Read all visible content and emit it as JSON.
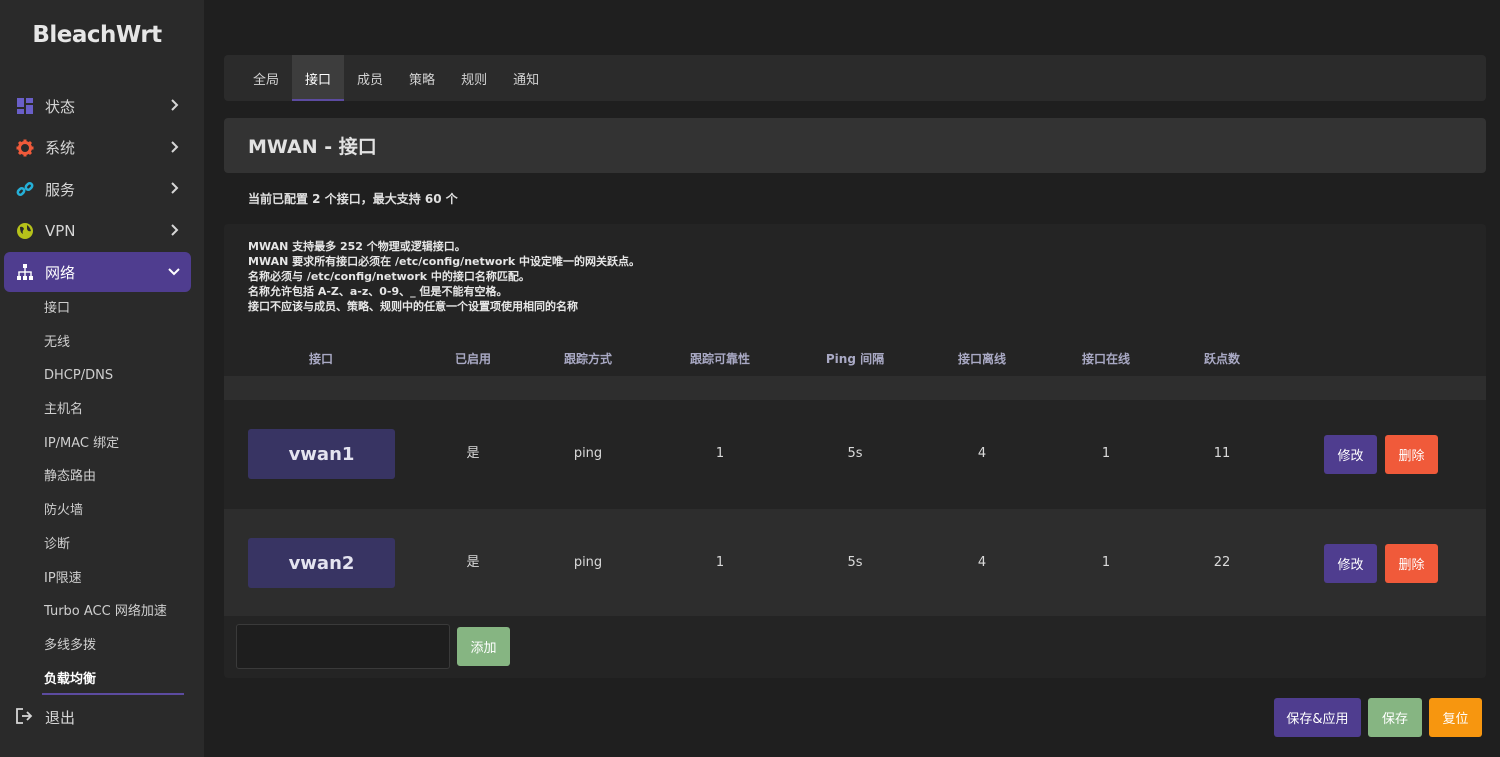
{
  "brand": "BleachWrt",
  "sidebar": {
    "items": [
      {
        "label": "状态",
        "icon": "dashboard-icon",
        "color": "#6a5fc8"
      },
      {
        "label": "系统",
        "icon": "gear-icon",
        "color": "#f05a3a"
      },
      {
        "label": "服务",
        "icon": "link-icon",
        "color": "#25b0d8"
      },
      {
        "label": "VPN",
        "icon": "globe-icon",
        "color": "#b6c21a"
      },
      {
        "label": "网络",
        "icon": "network-icon",
        "color": "#ffffff"
      }
    ],
    "network_sub": [
      "接口",
      "无线",
      "DHCP/DNS",
      "主机名",
      "IP/MAC 绑定",
      "静态路由",
      "防火墙",
      "诊断",
      "IP限速",
      "Turbo ACC 网络加速",
      "多线多拨",
      "负载均衡"
    ],
    "logout": "退出"
  },
  "tabs": [
    "全局",
    "接口",
    "成员",
    "策略",
    "规则",
    "通知"
  ],
  "active_tab": "接口",
  "page_title": "MWAN - 接口",
  "summary": "当前已配置 2 个接口，最大支持 60 个",
  "notes": [
    "MWAN 支持最多 252 个物理或逻辑接口。",
    "MWAN 要求所有接口必须在 /etc/config/network 中设定唯一的网关跃点。",
    "名称必须与 /etc/config/network 中的接口名称匹配。",
    "名称允许包括 A-Z、a-z、0-9、_ 但是不能有空格。",
    "接口不应该与成员、策略、规则中的任意一个设置项使用相同的名称"
  ],
  "table": {
    "headers": [
      "接口",
      "已启用",
      "跟踪方式",
      "跟踪可靠性",
      "Ping 间隔",
      "接口离线",
      "接口在线",
      "跃点数"
    ],
    "rows": [
      {
        "name": "vwan1",
        "enabled": "是",
        "track": "ping",
        "reliability": "1",
        "interval": "5s",
        "down": "4",
        "up": "1",
        "metric": "11"
      },
      {
        "name": "vwan2",
        "enabled": "是",
        "track": "ping",
        "reliability": "1",
        "interval": "5s",
        "down": "4",
        "up": "1",
        "metric": "22"
      }
    ],
    "edit_label": "修改",
    "delete_label": "删除"
  },
  "add_label": "添加",
  "add_input_value": "",
  "footer": {
    "apply": "保存&应用",
    "save": "保存",
    "reset": "复位"
  },
  "colors": {
    "accent": "#4f3d8f",
    "danger": "#f05a3a",
    "success": "#86b582",
    "warning": "#f7960f"
  }
}
